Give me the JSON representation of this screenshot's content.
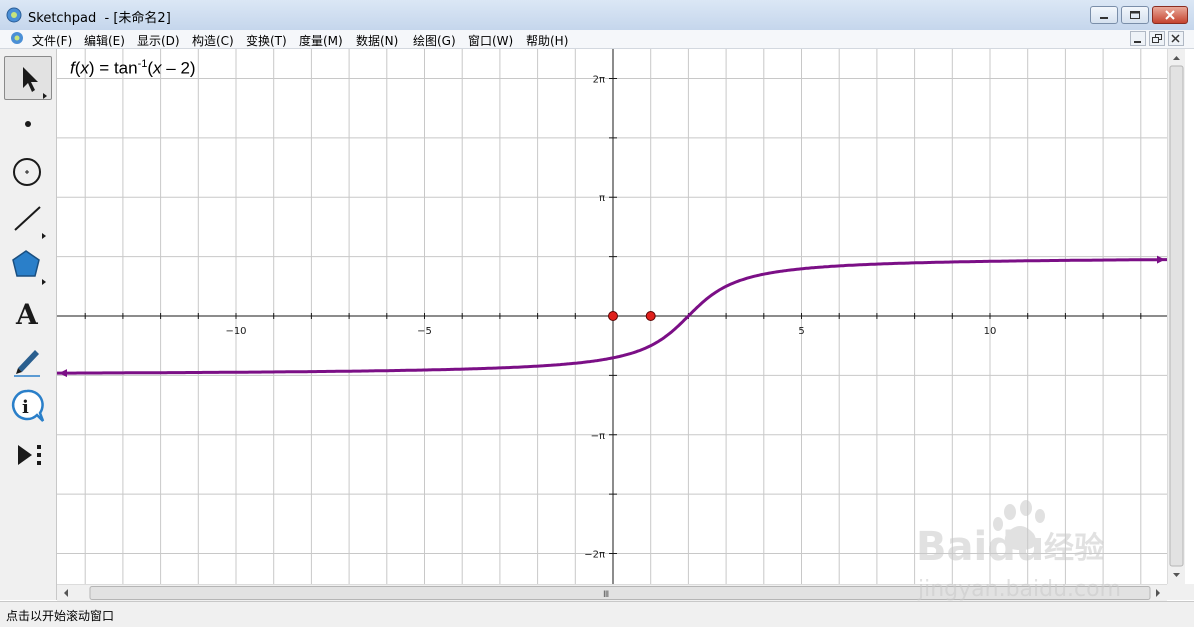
{
  "window": {
    "title": "Sketchpad  - [未命名2]"
  },
  "menu": {
    "items": [
      {
        "label": "文件(F)"
      },
      {
        "label": "编辑(E)"
      },
      {
        "label": "显示(D)"
      },
      {
        "label": "构造(C)"
      },
      {
        "label": "变换(T)"
      },
      {
        "label": "度量(M)"
      },
      {
        "label": "数据(N)"
      },
      {
        "label": "绘图(G)"
      },
      {
        "label": "窗口(W)"
      },
      {
        "label": "帮助(H)"
      }
    ]
  },
  "toolbox": {
    "tools": [
      "arrow-select-tool",
      "point-tool",
      "compass-tool",
      "straightedge-tool",
      "polygon-tool",
      "text-tool",
      "marker-tool",
      "information-tool",
      "custom-tool"
    ],
    "selected": "arrow-select-tool",
    "text_tool_glyph": "A"
  },
  "graph": {
    "function_label": {
      "f": "f",
      "x1": "x",
      "eq": " = tan",
      "sup": "-1",
      "paren_open": "(",
      "x2": "x",
      "rest": " – 2)"
    },
    "x_ticks": [
      {
        "value": -10,
        "label": "−10"
      },
      {
        "value": -5,
        "label": "−5"
      },
      {
        "value": 5,
        "label": "5"
      },
      {
        "value": 10,
        "label": "10"
      }
    ],
    "y_ticks": [
      {
        "value": 6.2832,
        "label": "2π"
      },
      {
        "value": 3.1416,
        "label": "π"
      },
      {
        "value": -3.1416,
        "label": "−π"
      },
      {
        "value": -6.2832,
        "label": "−2π"
      }
    ],
    "grid": true,
    "curve_color": "#7b0f86",
    "points_color": "#e0201c",
    "points": [
      {
        "x": 0,
        "y": 0
      },
      {
        "x": 1,
        "y": 0
      }
    ]
  },
  "scrollbars": {
    "hscroll_thumb_glyph": "Ⅲ"
  },
  "status": {
    "text": "点击以开始滚动窗口"
  },
  "watermark": {
    "brand": "Baidu",
    "cn": "经验",
    "url": "jingyan.baidu.com"
  }
}
